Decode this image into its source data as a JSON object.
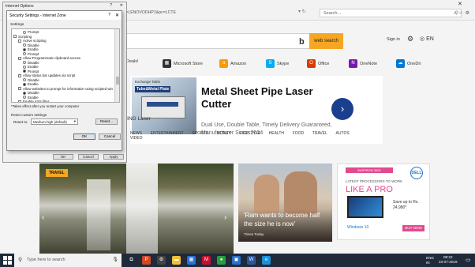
{
  "browser": {
    "window_title": "Internet Options",
    "url": "ayload=LENOVODHP1&pc=LCTE",
    "search_placeholder": "Search..."
  },
  "msn": {
    "web_search_label": "web search",
    "signin_label": "Sign in",
    "lang_label": "EN",
    "quicklinks": [
      {
        "label": "Deals!",
        "color": "#d6322a",
        "icon": "deals-icon"
      },
      {
        "label": "Microsoft Store",
        "color": "#333333",
        "icon": "store-icon"
      },
      {
        "label": "Amazon",
        "color": "#ff9900",
        "icon": "amazon-icon",
        "sub": "Sponsored"
      },
      {
        "label": "Skype",
        "color": "#00aff0",
        "icon": "skype-icon"
      },
      {
        "label": "Office",
        "color": "#d83b01",
        "icon": "office-icon"
      },
      {
        "label": "OneNote",
        "color": "#7719aa",
        "icon": "onenote-icon"
      },
      {
        "label": "OneDri",
        "color": "#0078d4",
        "icon": "onedrive-icon"
      }
    ],
    "ad": {
      "img_top": "Exchange Table",
      "img_title": "Tube&Metal Plate",
      "title": "Metal Sheet Pipe Laser Cutter",
      "subtitle": "Dual Use, Double Table, Timely Delivery Guaranteed, Manufacturer Since 2004",
      "brand": "LEIMING Laser",
      "go_arrow": "›"
    },
    "nav_items": [
      "NEWS",
      "ENTERTAINMENT",
      "SPORTS",
      "MONEY",
      "LIFESTYLE",
      "HEALTH",
      "FOOD",
      "TRAVEL",
      "AUTOS",
      "VIDEO"
    ],
    "travel_badge": "TRAVEL",
    "news_headline": "'Ram wants to become half the size he is now'",
    "news_source": "Times Today",
    "dell_ad": {
      "tag": "INSPIRON 3000",
      "logo": "DELL",
      "line1": "LATEST PROCESSORS TO WORK",
      "line2": "LIKE A PRO",
      "save": "Save up to Rs. 24,980*",
      "win10": "Windows 10",
      "buy": "BUY NOW"
    }
  },
  "dialog": {
    "title": "Security Settings - Internet Zone",
    "help": "?",
    "close": "✕",
    "settings_label": "Settings",
    "items": [
      {
        "type": "radio",
        "label": "Prompt",
        "on": false,
        "indent": 2,
        "row": 0
      },
      {
        "type": "check",
        "label": "Scripting",
        "indent": 0,
        "row": 1
      },
      {
        "type": "check",
        "label": "Active scripting",
        "indent": 1,
        "row": 2
      },
      {
        "type": "radio",
        "label": "Disable",
        "on": false,
        "indent": 2,
        "row": 3
      },
      {
        "type": "radio",
        "label": "Enable",
        "on": true,
        "indent": 2,
        "row": 4
      },
      {
        "type": "radio",
        "label": "Prompt",
        "on": false,
        "indent": 2,
        "row": 5
      },
      {
        "type": "check",
        "label": "Allow Programmatic clipboard access",
        "indent": 1,
        "row": 6
      },
      {
        "type": "radio",
        "label": "Disable",
        "on": false,
        "indent": 2,
        "row": 7
      },
      {
        "type": "radio",
        "label": "Enable",
        "on": false,
        "indent": 2,
        "row": 8
      },
      {
        "type": "radio",
        "label": "Prompt",
        "on": true,
        "indent": 2,
        "row": 9
      },
      {
        "type": "check",
        "label": "Allow status bar updates via script",
        "indent": 1,
        "row": 10
      },
      {
        "type": "radio",
        "label": "Disable",
        "on": false,
        "indent": 2,
        "row": 11
      },
      {
        "type": "radio",
        "label": "Enable",
        "on": true,
        "indent": 2,
        "row": 12
      },
      {
        "type": "check",
        "label": "Allow websites to prompt for information using scripted win",
        "indent": 1,
        "row": 13
      },
      {
        "type": "radio",
        "label": "Disable",
        "on": true,
        "indent": 2,
        "row": 14
      },
      {
        "type": "radio",
        "label": "Enable",
        "on": false,
        "indent": 2,
        "row": 15
      },
      {
        "type": "check",
        "label": "Enable XSS filter",
        "indent": 1,
        "row": 16
      }
    ],
    "note": "*Takes effect after you restart your computer",
    "reset_heading": "Reset custom settings",
    "reset_label": "Reset to:",
    "reset_value": "Medium-high (default)",
    "reset_button": "Reset...",
    "ok": "OK",
    "cancel": "Cancel"
  },
  "underlying_buttons": [
    "OK",
    "Cancel",
    "Apply"
  ],
  "taskbar": {
    "search_placeholder": "Type here to search",
    "apps": [
      {
        "name": "task-view-icon",
        "color": "#1f2a3a",
        "glyph": "⧉"
      },
      {
        "name": "powerpoint-icon",
        "color": "#d24726",
        "glyph": "P"
      },
      {
        "name": "settings-icon",
        "color": "#444444",
        "glyph": "⚙"
      },
      {
        "name": "file-explorer-icon",
        "color": "#f2c037",
        "glyph": "▬"
      },
      {
        "name": "store-icon",
        "color": "#2a72d6",
        "glyph": "▦"
      },
      {
        "name": "mcafee-icon",
        "color": "#c8102e",
        "glyph": "M"
      },
      {
        "name": "chrome-icon",
        "color": "#2a9d3f",
        "glyph": "●"
      },
      {
        "name": "photos-icon",
        "color": "#2b6fc7",
        "glyph": "▣"
      },
      {
        "name": "word-icon",
        "color": "#2b579a",
        "glyph": "W"
      },
      {
        "name": "ie-icon",
        "color": "#1c8fd8",
        "glyph": "e"
      }
    ],
    "lang_top": "ENG",
    "lang_bottom": "IN",
    "time": "08:22",
    "date": "23-07-2019"
  }
}
